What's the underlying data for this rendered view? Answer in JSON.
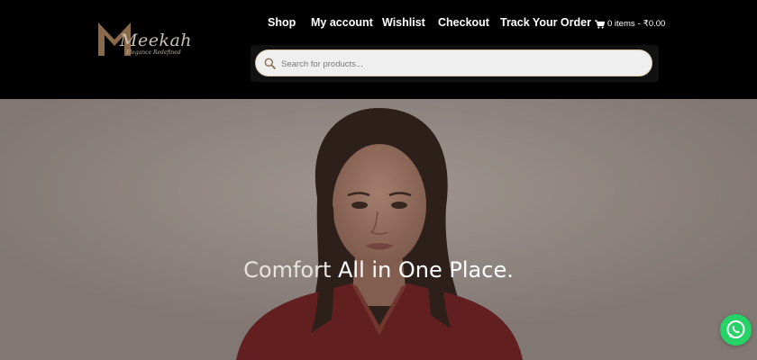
{
  "brand": {
    "name": "Meekah",
    "tagline": "Elegance Redefined",
    "colors": {
      "primary": "#8b6a4a",
      "accent": "#d8c9a5"
    }
  },
  "nav": {
    "items": [
      {
        "label": "Shop"
      },
      {
        "label": "My account"
      },
      {
        "label": "Wishlist"
      },
      {
        "label": "Checkout"
      },
      {
        "label": "Track Your Order"
      }
    ],
    "cart": {
      "icon": "cart-icon",
      "items_label": "0 items",
      "separator": "-",
      "total": "₹0.00"
    }
  },
  "search": {
    "placeholder": "Search for products...",
    "value": "",
    "icon": "search-icon"
  },
  "hero": {
    "headline_light": "Comfort",
    "headline_bold": "All in One Place."
  },
  "whatsapp": {
    "icon": "whatsapp-icon",
    "color": "#25d366"
  }
}
